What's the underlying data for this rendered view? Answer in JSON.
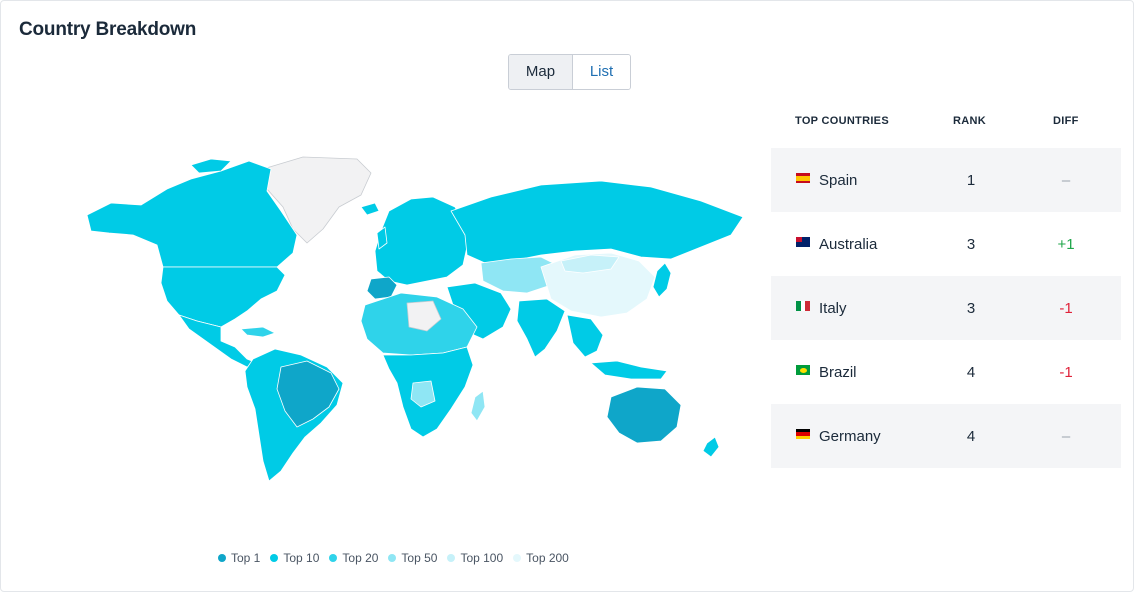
{
  "header": {
    "title": "Country Breakdown"
  },
  "view_toggle": {
    "map_label": "Map",
    "list_label": "List",
    "selected": "Map"
  },
  "table": {
    "col_country": "TOP COUNTRIES",
    "col_rank": "RANK",
    "col_diff": "DIFF",
    "rows": [
      {
        "country": "Spain",
        "rank": "1",
        "diff": "–",
        "diff_type": "neutral",
        "flag": "spain-flag-icon"
      },
      {
        "country": "Australia",
        "rank": "3",
        "diff": "+1",
        "diff_type": "positive",
        "flag": "australia-flag-icon"
      },
      {
        "country": "Italy",
        "rank": "3",
        "diff": "-1",
        "diff_type": "negative",
        "flag": "italy-flag-icon"
      },
      {
        "country": "Brazil",
        "rank": "4",
        "diff": "-1",
        "diff_type": "negative",
        "flag": "brazil-flag-icon"
      },
      {
        "country": "Germany",
        "rank": "4",
        "diff": "–",
        "diff_type": "neutral",
        "flag": "germany-flag-icon"
      }
    ]
  },
  "legend": {
    "items": [
      {
        "label": "Top 1",
        "color": "#0fa6c9"
      },
      {
        "label": "Top 10",
        "color": "#00cbe6"
      },
      {
        "label": "Top 20",
        "color": "#2fd3ea"
      },
      {
        "label": "Top 50",
        "color": "#8fe6f4"
      },
      {
        "label": "Top 100",
        "color": "#c6f1f9"
      },
      {
        "label": "Top 200",
        "color": "#e4f8fc"
      }
    ]
  },
  "colors": {
    "accent_link": "#1f6fb2",
    "positive": "#1fa64a",
    "negative": "#e0223a",
    "no_data": "#f2f2f3"
  }
}
